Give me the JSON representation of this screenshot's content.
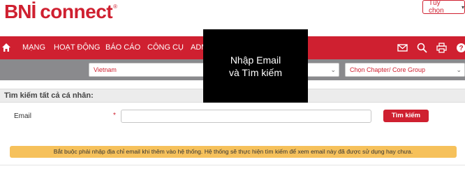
{
  "brand": {
    "name_part1": "BNİ",
    "name_part2": "connect",
    "registered": "®",
    "color": "#cf2030"
  },
  "header": {
    "options_label": "Tùy chọn",
    "options_caret": "▾"
  },
  "nav": {
    "items": [
      "MẠNG",
      "HOẠT ĐỘNG",
      "BÁO CÁO",
      "CÔNG CỤ",
      "ADM"
    ],
    "icons": [
      "home-icon",
      "mail-icon",
      "search-icon",
      "print-icon",
      "help-icon"
    ]
  },
  "filters": {
    "country": "Vietnam",
    "chapter": "Chọn Chapter/ Core Group"
  },
  "overlay": {
    "line1": "Nhập Email",
    "line2": "và Tìm kiếm"
  },
  "panel": {
    "title": "Tìm kiếm tất cả cá nhân:",
    "email_label": "Email",
    "required_mark": "*",
    "email_value": "",
    "search_button": "Tìm kiếm",
    "notice": "Bắt buộc phải nhập địa chỉ email khi thêm vào hệ thống. Hệ thống sẽ thực hiện tìm kiếm để xem email này đã được sử dụng hay chưa."
  }
}
